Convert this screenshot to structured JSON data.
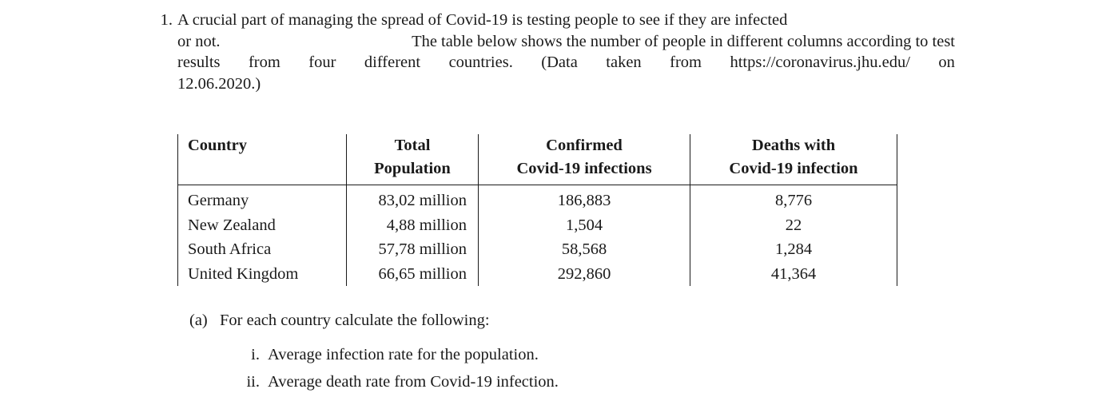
{
  "document": {
    "problem": {
      "marker": "1.",
      "lines": [
        [
          "A crucial part of managing the spread of Covid-19 is testing people to see if they are infected"
        ],
        [
          "or not.",
          "The table below shows the number of people in different columns according to test"
        ],
        [
          "results",
          "from",
          "four",
          "different",
          "countries.",
          "(Data",
          "taken",
          "from",
          "https://coronavirus.jhu.edu/",
          "on"
        ],
        [
          "12.06.2020.)"
        ]
      ],
      "full_text": "A crucial part of managing the spread of Covid-19 is testing people to see if they are infected or not. The table below shows the number of people in different columns according to test results from four different countries. (Data taken from https://coronavirus.jhu.edu/ on 12.06.2020.)"
    },
    "table": {
      "headers_line1": [
        "Country",
        "Total",
        "Confirmed",
        "Deaths with"
      ],
      "headers_line2": [
        "",
        "Population",
        "Covid-19 infections",
        "Covid-19 infection"
      ],
      "rows": [
        {
          "country": "Germany",
          "population": "83,02 million",
          "confirmed": "186,883",
          "deaths": "8,776"
        },
        {
          "country": "New Zealand",
          "population": "4,88 million",
          "confirmed": "1,504",
          "deaths": "22"
        },
        {
          "country": "South Africa",
          "population": "57,78 million",
          "confirmed": "58,568",
          "deaths": "1,284"
        },
        {
          "country": "United Kingdom",
          "population": "66,65 million",
          "confirmed": "292,860",
          "deaths": "41,364"
        }
      ]
    },
    "part_a": {
      "marker": "(a)",
      "text": "For each country calculate the following:",
      "subitems": [
        {
          "marker": "i.",
          "text": "Average infection rate for the population."
        },
        {
          "marker": "ii.",
          "text": "Average death rate from Covid-19 infection."
        }
      ]
    }
  },
  "colors": {
    "text": "#1a1a1a",
    "rule": "#1a1a1a",
    "background": "#ffffff"
  }
}
